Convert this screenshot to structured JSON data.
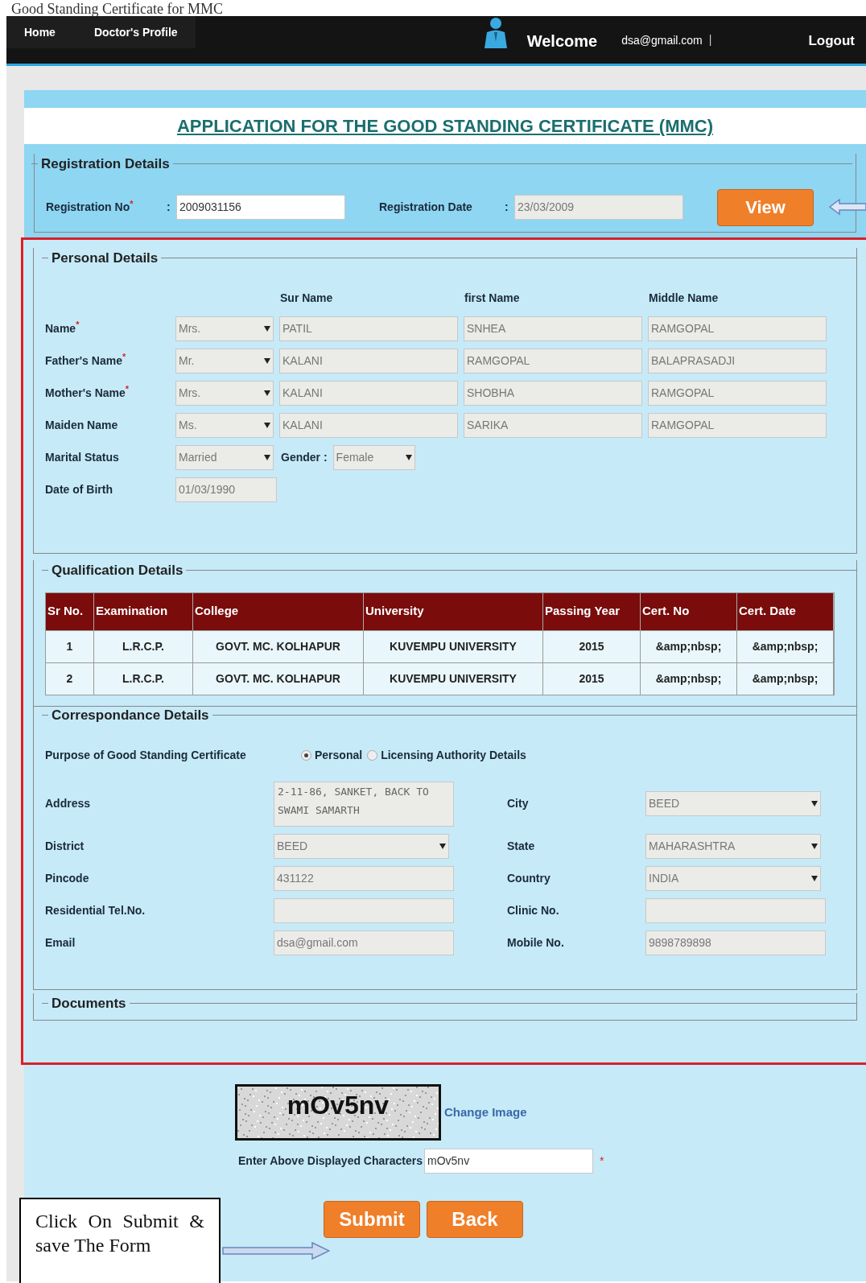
{
  "caption": "Good Standing Certificate for MMC",
  "nav": {
    "links": [
      "Home",
      "Doctor's Profile"
    ],
    "welcome": "Welcome",
    "email": "dsa@gmail.com",
    "separator": "|",
    "logout": "Logout"
  },
  "title": "APPLICATION FOR THE GOOD STANDING CERTIFICATE (MMC)",
  "required_mark": "*",
  "registration": {
    "legend": "Registration Details",
    "no_label": "Registration No",
    "no_required": true,
    "no_value": "2009031156",
    "no_disabled": false,
    "date_label": "Registration Date",
    "date_value": "23/03/2009",
    "date_disabled": true,
    "colon": ":",
    "view_button": "View"
  },
  "personal": {
    "legend": "Personal Details",
    "disabled": true,
    "columns": [
      "Sur Name",
      "first Name",
      "Middle Name"
    ],
    "rows": [
      {
        "label": "Name",
        "required": true,
        "title": "Mrs.",
        "surname": "PATIL",
        "first": "SNHEA",
        "middle": "RAMGOPAL"
      },
      {
        "label": "Father's Name",
        "required": true,
        "title": "Mr.",
        "surname": "KALANI",
        "first": "RAMGOPAL",
        "middle": "BALAPRASADJI"
      },
      {
        "label": "Mother's Name",
        "required": true,
        "title": "Mrs.",
        "surname": "KALANI",
        "first": "SHOBHA",
        "middle": "RAMGOPAL"
      },
      {
        "label": "Maiden Name",
        "required": false,
        "title": "Ms.",
        "surname": "KALANI",
        "first": "SARIKA",
        "middle": "RAMGOPAL"
      }
    ],
    "marital": {
      "label": "Marital Status",
      "value": "Married"
    },
    "gender": {
      "label": "Gender :",
      "value": "Female"
    },
    "dob": {
      "label": "Date of Birth",
      "value": "01/03/1990"
    }
  },
  "qualification": {
    "legend": "Qualification Details",
    "columns": [
      "Sr No.",
      "Examination",
      "College",
      "University",
      "Passing Year",
      "Cert. No",
      "Cert. Date"
    ],
    "rows": [
      [
        "1",
        "L.R.C.P.",
        "GOVT. MC. KOLHAPUR",
        "KUVEMPU UNIVERSITY",
        "2015",
        "&amp;nbsp;",
        "&amp;nbsp;"
      ],
      [
        "2",
        "L.R.C.P.",
        "GOVT. MC. KOLHAPUR",
        "KUVEMPU UNIVERSITY",
        "2015",
        "&amp;nbsp;",
        "&amp;nbsp;"
      ]
    ]
  },
  "correspondence": {
    "legend": "Correspondance Details",
    "disabled": true,
    "purpose_label": "Purpose of Good Standing Certificate",
    "purpose_options": [
      {
        "label": "Personal",
        "selected": true
      },
      {
        "label": "Licensing Authority Details",
        "selected": false
      }
    ],
    "fields": [
      {
        "label": "Address",
        "kind": "textarea",
        "value": "2-11-86, SANKET, BACK TO SWAMI SAMARTH"
      },
      {
        "label": "City",
        "kind": "select",
        "value": "BEED"
      },
      {
        "label": "District",
        "kind": "select",
        "value": "BEED"
      },
      {
        "label": "State",
        "kind": "select",
        "value": "MAHARASHTRA"
      },
      {
        "label": "Pincode",
        "kind": "text",
        "value": "431122"
      },
      {
        "label": "Country",
        "kind": "select",
        "value": "INDIA"
      },
      {
        "label": "Residential Tel.No.",
        "kind": "text"
      },
      {
        "label": "Clinic No.",
        "kind": "text"
      },
      {
        "label": "Email",
        "kind": "text",
        "value": "dsa@gmail.com"
      },
      {
        "label": "Mobile No.",
        "kind": "text",
        "value": "9898789898"
      }
    ]
  },
  "documents": {
    "legend": "Documents"
  },
  "captcha": {
    "text": "mOv5nv",
    "change_link": "Change Image",
    "input_label": "Enter Above Displayed Characters",
    "input_value": "mOv5nv",
    "required": true
  },
  "buttons": [
    "Submit",
    "Back"
  ],
  "callout": {
    "text": "Click On Submit & save The Form"
  }
}
